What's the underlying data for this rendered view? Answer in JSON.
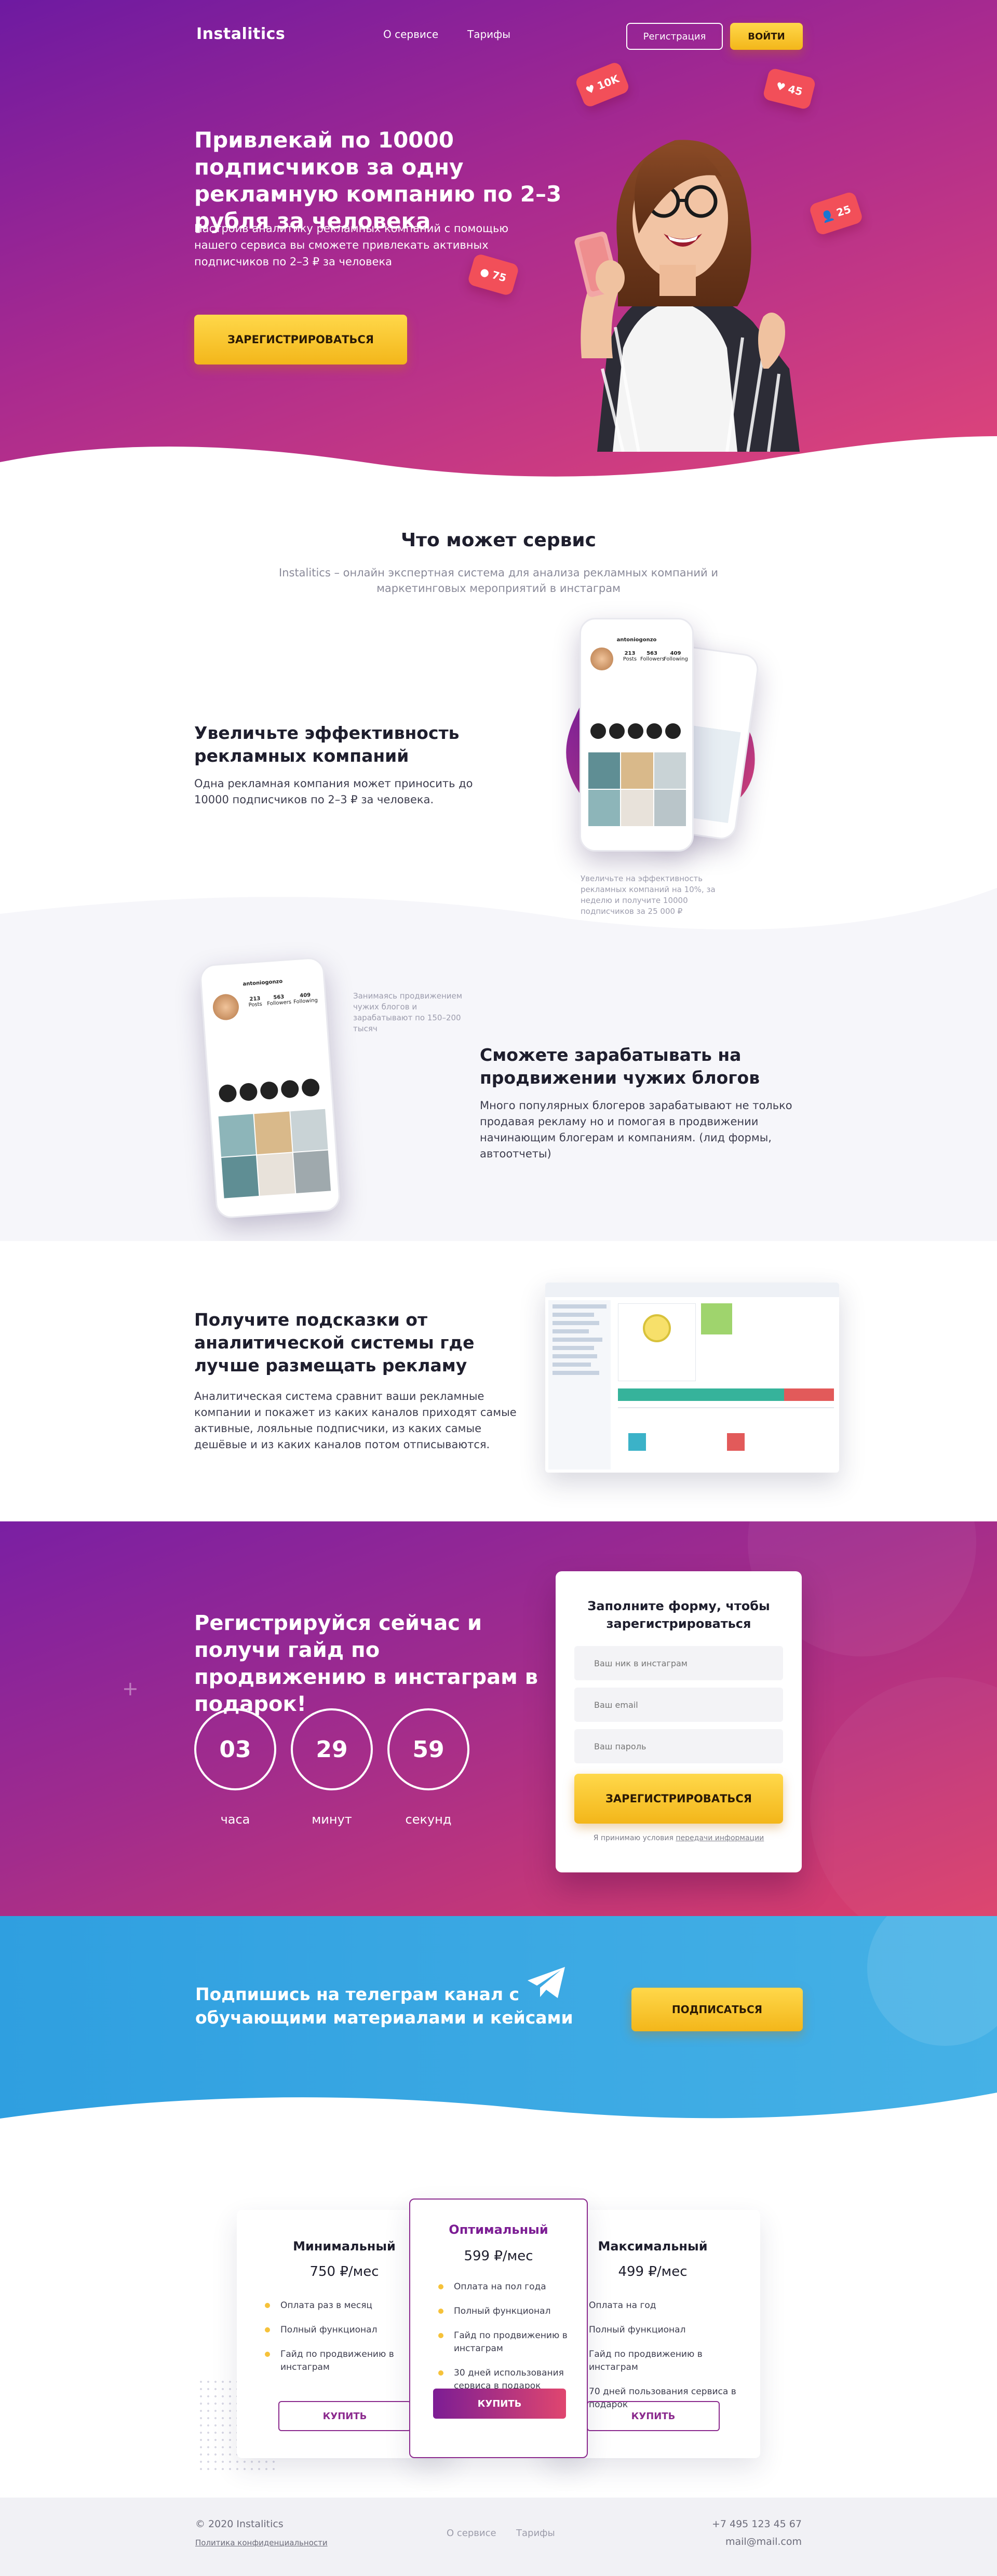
{
  "header": {
    "logo": "Instalitics",
    "nav": [
      "О сервисе",
      "Тарифы"
    ],
    "register_label": "Регистрация",
    "login_label": "ВОЙТИ"
  },
  "hero": {
    "title": "Привлекай по 10000 подписчиков за одну рекламную компанию по 2–3 рубля за человека",
    "subtitle": "Настроив аналитику рекламных компаний с помощью нашего сервиса вы сможете привлекать активных подписчиков по 2–3 ₽ за человека",
    "cta_label": "ЗАРЕГИСТРИРОВАТЬСЯ",
    "notifications": [
      {
        "icon": "heart-icon",
        "count": "10K"
      },
      {
        "icon": "heart-icon",
        "count": "45"
      },
      {
        "icon": "user-icon",
        "count": "25"
      },
      {
        "icon": "comment-icon",
        "count": "75"
      }
    ]
  },
  "service": {
    "title": "Что может сервис",
    "subtitle": "Instalitics – онлайн экспертная система для анализа рекламных компаний и маркетинговых мероприятий в инстаграм",
    "features": [
      {
        "title": "Увеличьте эффективность рекламных компаний",
        "text": "Одна рекламная компания может приносить до 10000 подписчиков по 2–3 ₽ за человека.",
        "caption": "Увеличьте на эффективность рекламных компаний на 10%, за неделю и получите 10000 подписчиков за 25 000 ₽"
      },
      {
        "title": "Сможете зарабатывать на продвижении чужих блогов",
        "text": "Много популярных блогеров зарабатывают не только продавая рекламу но и помогая в продвижении начинающим блогерам и компаниям. (лид формы, автоотчеты)",
        "caption": "Занимаясь продвижением чужих блогов и зарабатывают по 150–200 тысяч"
      },
      {
        "title": "Получите подсказки от аналитической системы где лучше размещать рекламу",
        "text": "Аналитическая система сравнит ваши рекламные компании и покажет из каких каналов приходят самые активные, лояльные подписчики, из каких самые дешёвые и из каких каналов потом отписываются."
      }
    ],
    "phone": {
      "username": "antoniogonzo",
      "posts": "213",
      "posts_label": "Posts",
      "followers": "563",
      "followers_label": "Followers",
      "following": "409",
      "following_label": "Following"
    }
  },
  "register": {
    "title": "Регистрируйся сейчас и получи гайд по продвижению в инстаграм в подарок!",
    "timer": [
      {
        "value": "03",
        "label": "часа"
      },
      {
        "value": "29",
        "label": "минут"
      },
      {
        "value": "59",
        "label": "секунд"
      }
    ],
    "form": {
      "title": "Заполните форму, чтобы зарегистрироваться",
      "fields": [
        "Ваш ник в инстаграм",
        "Ваш email",
        "Ваш пароль"
      ],
      "submit_label": "ЗАРЕГИСТРИРОВАТЬСЯ",
      "note": "Я принимаю условия",
      "note_link": "передачи информации"
    }
  },
  "telegram": {
    "title": "Подпишись на телеграм канал с обучающими материалами и кейсами",
    "button_label": "ПОДПИСАТЬСЯ"
  },
  "pricing": {
    "plans": [
      {
        "name": "Минимальный",
        "price": "750 ₽/мес",
        "features": [
          "Оплата раз в месяц",
          "Полный функционал",
          "Гайд по продвижению в инстаграм"
        ],
        "button_label": "КУПИТЬ"
      },
      {
        "name": "Оптимальный",
        "price": "599 ₽/мес",
        "features": [
          "Оплата на пол года",
          "Полный функционал",
          "Гайд по продвижению в инстаграм",
          "30 дней использования сервиса в подарок"
        ],
        "button_label": "КУПИТЬ"
      },
      {
        "name": "Максимальный",
        "price": "499 ₽/мес",
        "features": [
          "Оплата на год",
          "Полный функционал",
          "Гайд по продвижению в инстаграм",
          "70 дней пользования сервиса в подарок"
        ],
        "button_label": "КУПИТЬ"
      }
    ]
  },
  "footer": {
    "copyright": "© 2020 Instalitics",
    "policy": "Политика конфиденциальности",
    "nav": [
      "О сервисе",
      "Тарифы"
    ],
    "phone": "+7 495 123 45 67",
    "email": "mail@mail.com"
  },
  "colors": {
    "accent_purple": "#7a1fa3",
    "accent_pink": "#e14679",
    "accent_yellow": "#f6c23a",
    "telegram_blue": "#35a6e2"
  }
}
